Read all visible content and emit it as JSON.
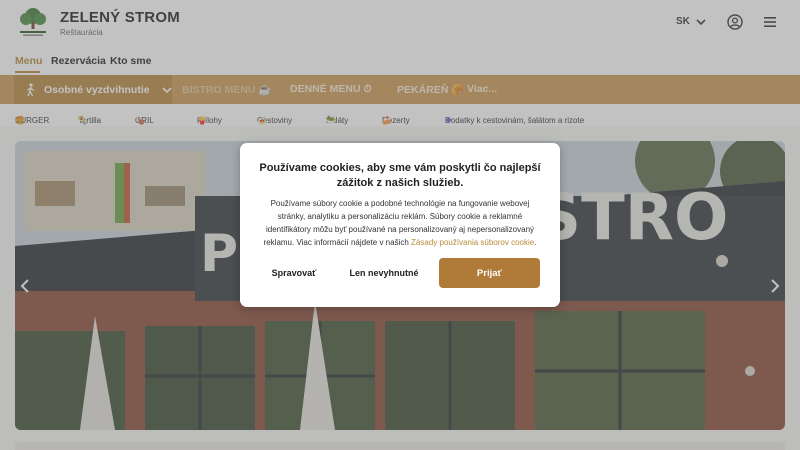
{
  "header": {
    "brand_title": "ZELENÝ STROM",
    "brand_subtitle": "Reštaurácia",
    "logo_icon": "tree-logo",
    "language": "SK"
  },
  "topnav": {
    "items": [
      "Menu",
      "Rezervácia",
      "Kto sme"
    ],
    "active": "Menu"
  },
  "orange_bar": {
    "pickup_label": "Osobné vyzdvihnutie",
    "tabs": [
      "BISTRO MENU",
      "DENNÉ MENU",
      "PEKÁREŇ",
      "Viac..."
    ]
  },
  "categories": [
    "BURGER",
    "Tortilla",
    "GRIL",
    "Prílohy",
    "Cestoviny",
    "Šaláty",
    "Dezerty",
    "Dodatky k cestovinám, šalátom a rizote"
  ],
  "hero": {
    "sign_text": "PE",
    "sign_text_right": "STRO"
  },
  "cookie_modal": {
    "title": "Používame cookies, aby sme vám poskytli čo najlepší zážitok z našich služieb.",
    "body": "Používame súbory cookie a podobné technológie na fungovanie webovej stránky, analytiku a personalizáciu reklám. Súbory cookie a reklamné identifikátory môžu byť používané na personalizovaný aj nepersonalizovaný reklamu. Viac informácií nájdete v našich ",
    "policy_link": "Zásady používania súborov cookie",
    "manage_label": "Spravovať",
    "necessary_label": "Len nevyhnutné",
    "accept_label": "Prijať"
  },
  "colors": {
    "accent": "#b07a38",
    "orange_bar": "#cc9a53",
    "pickup_bg": "#b9893f"
  }
}
